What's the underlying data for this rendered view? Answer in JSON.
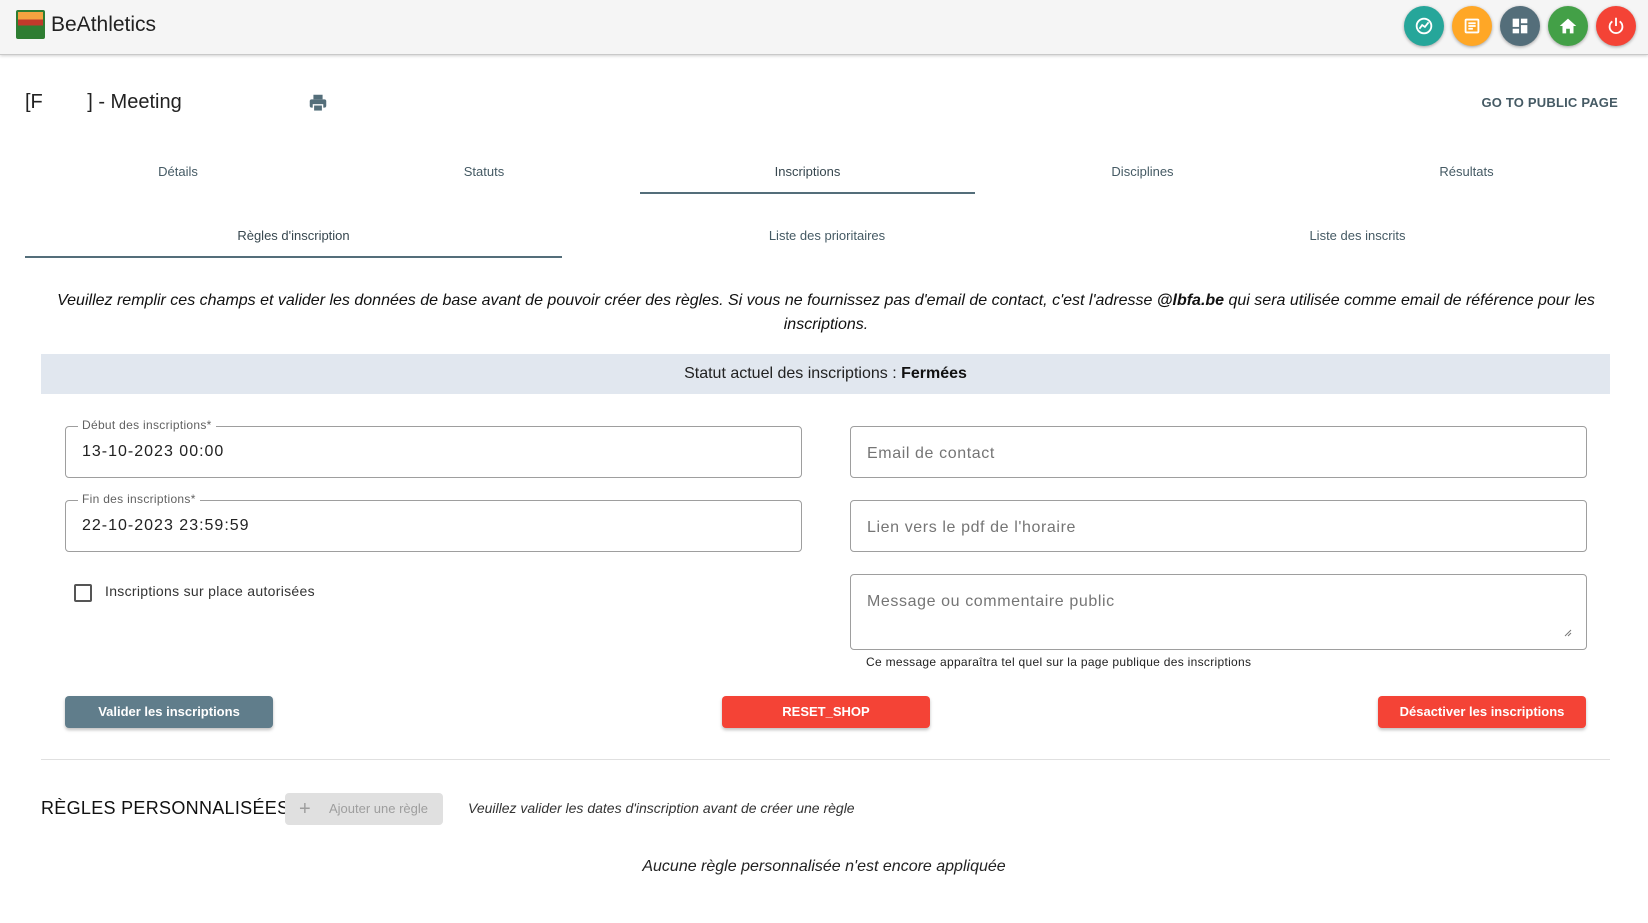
{
  "app": {
    "brand": "BeAthletics",
    "icons": [
      {
        "name": "stats-icon",
        "color": "#26a69a"
      },
      {
        "name": "news-icon",
        "color": "#ffa726"
      },
      {
        "name": "dashboard-icon",
        "color": "#546e7a"
      },
      {
        "name": "home-icon",
        "color": "#43a047"
      },
      {
        "name": "power-icon",
        "color": "#f44336"
      }
    ]
  },
  "header": {
    "title": "[F        ] - Meeting",
    "public_link": "GO TO PUBLIC PAGE"
  },
  "tabs": [
    "Détails",
    "Statuts",
    "Inscriptions",
    "Disciplines",
    "Résultats"
  ],
  "active_tab": "Inscriptions",
  "subtabs": [
    "Règles d'inscription",
    "Liste des prioritaires",
    "Liste des inscrits"
  ],
  "active_subtab": "Règles d'inscription",
  "notice": {
    "text_before": "Veuillez remplir ces champs et valider les données de base avant de pouvoir créer des règles. Si vous ne fournissez pas d'email de contact, c'est l'adresse ",
    "email": "@lbfa.be",
    "text_after": " qui sera utilisée comme email de référence pour les inscriptions."
  },
  "status": {
    "label": "Statut actuel des inscriptions : ",
    "value": "Fermées"
  },
  "form": {
    "start": {
      "label": "Début des inscriptions*",
      "value": "13-10-2023 00:00"
    },
    "end": {
      "label": "Fin des inscriptions*",
      "value": "22-10-2023 23:59:59"
    },
    "onsite_label": "Inscriptions sur place autorisées",
    "onsite_checked": false,
    "email_placeholder": "Email de contact",
    "pdf_placeholder": "Lien vers le pdf de l'horaire",
    "message_placeholder": "Message ou commentaire public",
    "message_hint": "Ce message apparaîtra tel quel sur la page publique des inscriptions"
  },
  "buttons": {
    "validate": "Valider les inscriptions",
    "reset": "RESET_SHOP",
    "deactivate": "Désactiver les inscriptions"
  },
  "rules": {
    "title": "RÈGLES PERSONNALISÉES",
    "add_label": "Ajouter une règle",
    "hint": "Veuillez valider les dates d'inscription avant de créer une règle",
    "empty": "Aucune règle personnalisée n'est encore appliquée"
  }
}
